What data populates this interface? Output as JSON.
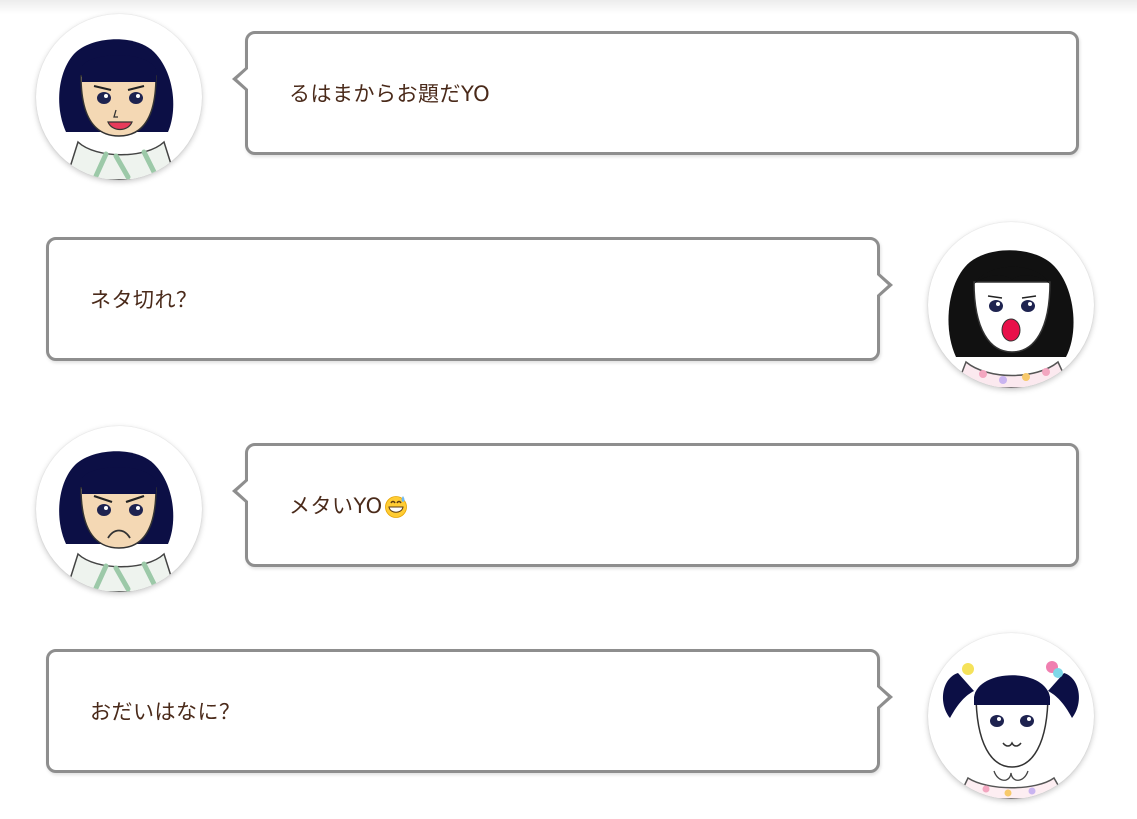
{
  "messages": [
    {
      "side": "left",
      "avatar_icon": "girl-smiling-icon",
      "text": "るはまからお題だYO"
    },
    {
      "side": "right",
      "avatar_icon": "girl-surprised-icon",
      "text": "ネタ切れ？"
    },
    {
      "side": "left",
      "avatar_icon": "girl-pouting-icon",
      "text": "メタいYO",
      "emoji": "grinning-sweat-emoji"
    },
    {
      "side": "right",
      "avatar_icon": "girl-twintails-icon",
      "text": "おだいはなに？"
    }
  ],
  "colors": {
    "bubble_border": "#8e8e8e",
    "text": "#4a2a1a",
    "hair": "#0c0f45",
    "skin": "#f4d8b4"
  }
}
